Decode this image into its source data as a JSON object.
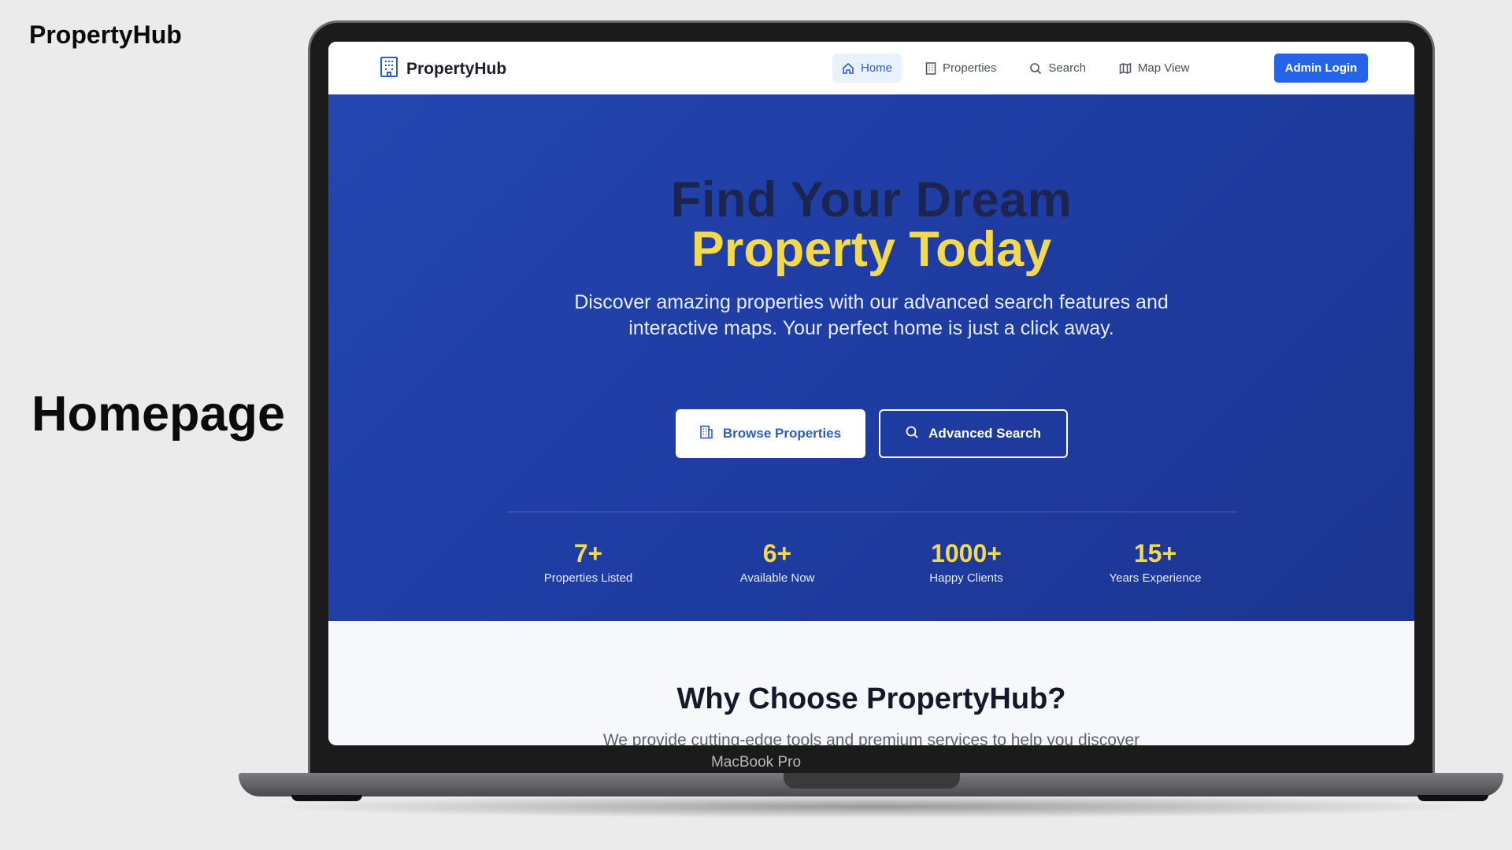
{
  "slide": {
    "brand": "PropertyHub",
    "title": "Homepage",
    "device_label": "MacBook Pro"
  },
  "navbar": {
    "brand": "PropertyHub",
    "items": [
      {
        "label": "Home",
        "icon": "home-icon",
        "active": true
      },
      {
        "label": "Properties",
        "icon": "building-icon",
        "active": false
      },
      {
        "label": "Search",
        "icon": "search-icon",
        "active": false
      },
      {
        "label": "Map View",
        "icon": "map-icon",
        "active": false
      }
    ],
    "admin_login": "Admin Login"
  },
  "hero": {
    "title_line1": "Find Your Dream",
    "title_line2": "Property Today",
    "subtitle_line1": "Discover amazing properties with our advanced search features and",
    "subtitle_line2": "interactive maps. Your perfect home is just a click away.",
    "browse_button": "Browse Properties",
    "search_button": "Advanced Search",
    "stats": [
      {
        "value": "7+",
        "label": "Properties Listed"
      },
      {
        "value": "6+",
        "label": "Available Now"
      },
      {
        "value": "1000+",
        "label": "Happy Clients"
      },
      {
        "value": "15+",
        "label": "Years Experience"
      }
    ]
  },
  "why": {
    "title": "Why Choose PropertyHub?",
    "subtitle": "We provide cutting-edge tools and premium services to help you discover"
  },
  "colors": {
    "accent": "#2563eb",
    "hero_bg": "#1f3da4",
    "highlight": "#f5d94c",
    "dark_text": "#141a2b"
  }
}
